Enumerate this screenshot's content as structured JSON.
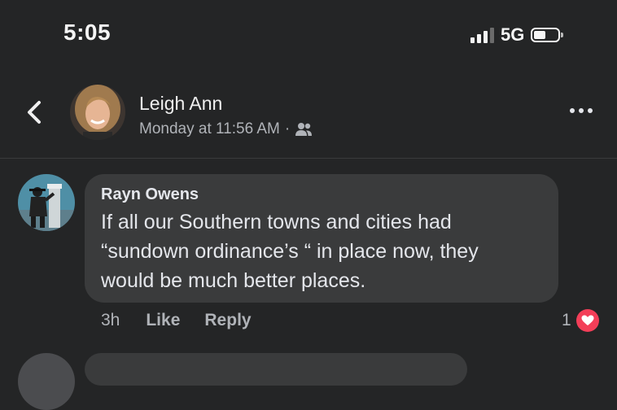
{
  "status_bar": {
    "time": "5:05",
    "network": "5G"
  },
  "post": {
    "author": "Leigh Ann",
    "timestamp": "Monday at 11:56 AM",
    "separator": "·",
    "audience_icon": "friends-icon"
  },
  "comment": {
    "author": "Rayn Owens",
    "lines": [
      "If all our Southern towns and cities had",
      "“sundown ordinance’s “ in place now, they",
      "would be much better places."
    ],
    "age": "3h",
    "like_label": "Like",
    "reply_label": "Reply",
    "reaction_count": "1",
    "reaction_icon": "heart-icon"
  },
  "colors": {
    "background": "#242526",
    "bubble": "#3a3b3c",
    "heart": "#f33e58",
    "secondary_text": "#b0b3b8"
  }
}
